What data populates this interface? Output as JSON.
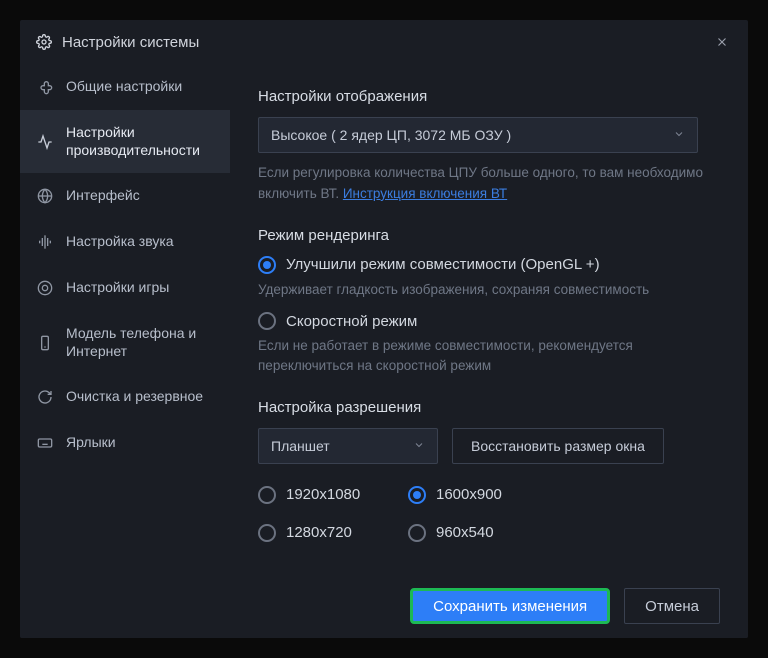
{
  "titlebar": {
    "title": "Настройки системы"
  },
  "sidebar": {
    "items": [
      {
        "label": "Общие настройки"
      },
      {
        "label": "Настройки производительности"
      },
      {
        "label": "Интерфейс"
      },
      {
        "label": "Настройка звука"
      },
      {
        "label": "Настройки игры"
      },
      {
        "label": "Модель телефона и Интернет"
      },
      {
        "label": "Очистка и резервное"
      },
      {
        "label": "Ярлыки"
      }
    ]
  },
  "content": {
    "display_settings_title": "Настройки отображения",
    "display_dropdown": "Высокое ( 2 ядер ЦП, 3072 МБ ОЗУ )",
    "display_hint_a": "Если регулировка количества ЦПУ больше одного, то вам необходимо включить ВТ. ",
    "display_hint_link": "Инструкция включения ВТ",
    "render_title": "Режим рендеринга",
    "render_opt1": "Улучшили режим совместимости (OpenGL +)",
    "render_opt1_desc": "Удерживает гладкость изображения, сохраняя совместимость",
    "render_opt2": "Скоростной режим",
    "render_opt2_desc": "Если не работает в режиме совместимости, рекомендуется переключиться на скоростной режим",
    "resolution_title": "Настройка разрешения",
    "resolution_dropdown": "Планшет",
    "restore_btn": "Восстановить размер окна",
    "res": {
      "a": "1920x1080",
      "b": "1600x900",
      "c": "1280x720",
      "d": "960x540"
    }
  },
  "footer": {
    "save": "Сохранить изменения",
    "cancel": "Отмена"
  }
}
